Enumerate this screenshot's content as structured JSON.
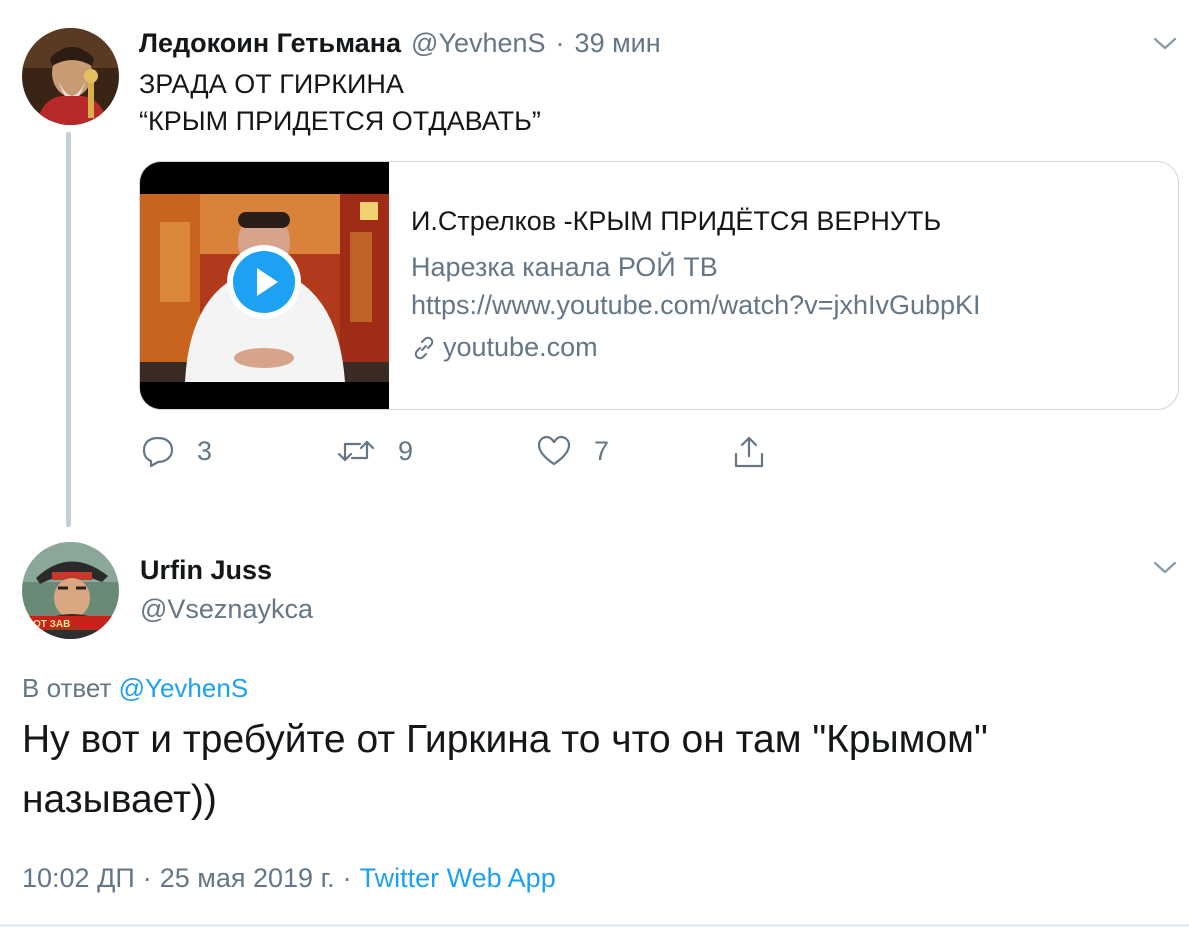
{
  "tweet1": {
    "author_name": "Ледокоин Гетьмана",
    "handle": "@YevhenS",
    "separator": "·",
    "time": "39 мин",
    "text_lines": [
      "ЗРАДА ОТ ГИРКИНА",
      "“КРЫМ ПРИДЕТСЯ ОТДАВАТЬ”"
    ],
    "card": {
      "title": "И.Стрелков -КРЫМ ПРИДЁТСЯ ВЕРНУТЬ",
      "description": "Нарезка канала РОЙ ТВ",
      "url": "https://www.youtube.com/watch?v=jxhIvGubpKI",
      "domain": "youtube.com"
    },
    "actions": {
      "reply_count": "3",
      "retweet_count": "9",
      "like_count": "7"
    }
  },
  "tweet2": {
    "author_name": "Urfin Juss",
    "handle": "@Vseznaykca",
    "avatar_badge": "ВОТ ЗАВ",
    "reply_prefix": "В ответ",
    "reply_to": "@YevhenS",
    "text_lines": [
      "Ну вот и требуйте от Гиркина то что он там \"Крымом\"",
      "называет))"
    ],
    "time": "10:02 ДП",
    "date": "25 мая 2019 г.",
    "separator": "·",
    "source": "Twitter Web App"
  },
  "colors": {
    "link": "#1da1f2",
    "muted": "#657786",
    "text": "#14171a",
    "border": "#ccd6dd",
    "thread_line": "#c4cfd6"
  },
  "icons": [
    "chevron-down-icon",
    "play-icon",
    "link-icon",
    "reply-icon",
    "retweet-icon",
    "like-icon",
    "share-icon"
  ]
}
